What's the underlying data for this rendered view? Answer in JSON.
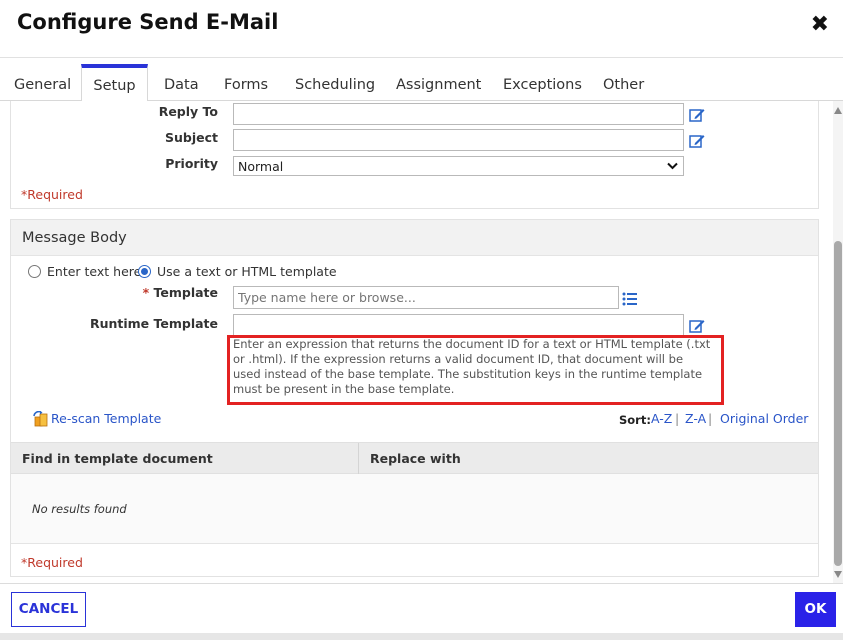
{
  "dialog": {
    "title": "Configure Send E-Mail",
    "close_label": "✖"
  },
  "tabs": [
    {
      "label": "General"
    },
    {
      "label": "Setup",
      "active": true
    },
    {
      "label": "Data"
    },
    {
      "label": "Forms"
    },
    {
      "label": "Scheduling"
    },
    {
      "label": "Assignment"
    },
    {
      "label": "Exceptions"
    },
    {
      "label": "Other"
    }
  ],
  "email_settings": {
    "reply_to_label": "Reply To",
    "reply_to_value": "",
    "subject_label": "Subject",
    "subject_value": "",
    "priority_label": "Priority",
    "priority_value": "Normal",
    "required_note": "*Required"
  },
  "message_body": {
    "section_title": "Message Body",
    "option_text": "Enter text here",
    "option_template": "Use a text or HTML template",
    "selected_option": "template",
    "required_star": "*",
    "template_label": "Template",
    "template_placeholder": "Type name here or browse...",
    "runtime_template_label": "Runtime Template",
    "runtime_template_value": "",
    "runtime_help": "Enter an expression that returns the document ID for a text or HTML template (.txt or .html). If the expression returns a valid document ID, that document will be used instead of the base template. The substitution keys in the runtime template must be present in the base template.",
    "rescan_label": "Re-scan Template",
    "sort_label": "Sort:",
    "sort_az": "A-Z",
    "sort_za": "Z-A",
    "sort_original": "Original Order",
    "separator": "|",
    "table_headers": [
      "Find in template document",
      "Replace with"
    ],
    "empty_message": "No results found",
    "required_note": "*Required"
  },
  "footer": {
    "cancel_label": "CANCEL",
    "ok_label": "OK"
  },
  "colors": {
    "accent": "#2a33d8",
    "ok_button": "#2a22e8",
    "required": "#c0392b",
    "highlight": "#e32222",
    "link": "#2a55c8"
  }
}
